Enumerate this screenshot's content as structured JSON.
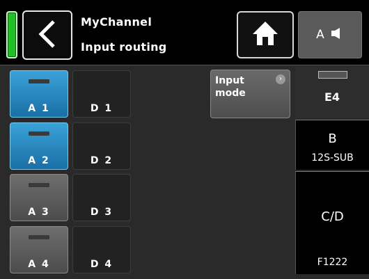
{
  "header": {
    "channel_name": "MyChannel",
    "page_name": "Input routing",
    "amp_button": "A"
  },
  "inputs": {
    "analog": [
      "A 1",
      "A 2",
      "A 3",
      "A 4"
    ],
    "digital": [
      "D 1",
      "D 2",
      "D 3",
      "D 4"
    ],
    "selected": [
      "A 1",
      "A 2"
    ]
  },
  "input_mode": {
    "label_line1": "Input",
    "label_line2": "mode",
    "more_icon": "chevron-right-icon"
  },
  "outputs": [
    {
      "label": "E4",
      "subtitle": "",
      "active": true
    },
    {
      "label": "B",
      "subtitle": "12S-SUB",
      "active": false
    },
    {
      "label": "C/D",
      "subtitle": "F1222",
      "active": false
    }
  ],
  "colors": {
    "status": "#22c026",
    "selected": "#2a8ac6",
    "background": "#2a2a2a"
  }
}
